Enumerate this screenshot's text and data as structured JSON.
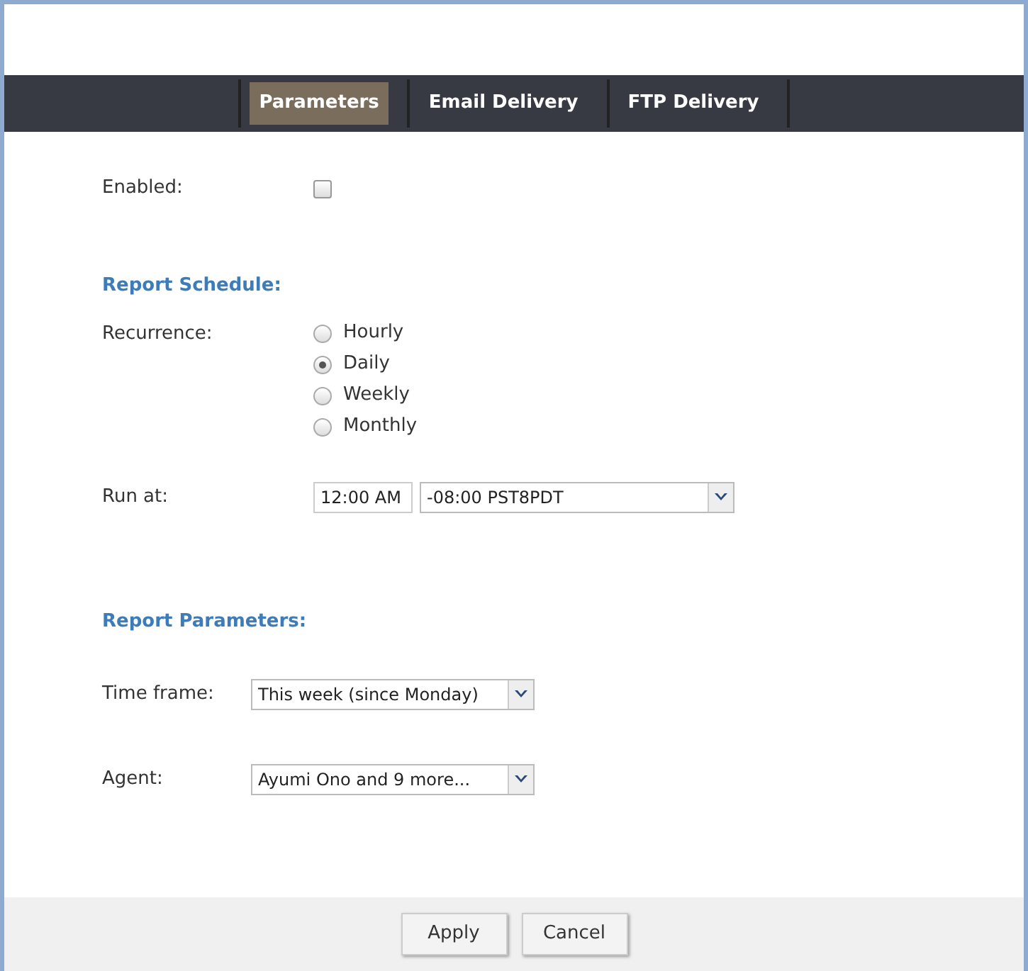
{
  "tabs": [
    {
      "label": "Parameters",
      "selected": true
    },
    {
      "label": "Email Delivery",
      "selected": false
    },
    {
      "label": "FTP Delivery",
      "selected": false
    }
  ],
  "enabled": {
    "label": "Enabled:",
    "checked": false
  },
  "report_schedule": {
    "heading": "Report Schedule:",
    "recurrence_label": "Recurrence:",
    "recurrence_options": [
      {
        "label": "Hourly",
        "selected": false
      },
      {
        "label": "Daily",
        "selected": true
      },
      {
        "label": "Weekly",
        "selected": false
      },
      {
        "label": "Monthly",
        "selected": false
      }
    ],
    "run_at_label": "Run at:",
    "time_value": "12:00 AM",
    "timezone_value": "-08:00 PST8PDT"
  },
  "report_parameters": {
    "heading": "Report Parameters:",
    "fields": [
      {
        "label": "Time frame:",
        "value": "This week (since Monday)"
      },
      {
        "label": "Agent:",
        "value": "Ayumi Ono and 9 more..."
      }
    ]
  },
  "buttons": [
    {
      "label": "Apply"
    },
    {
      "label": "Cancel"
    }
  ]
}
